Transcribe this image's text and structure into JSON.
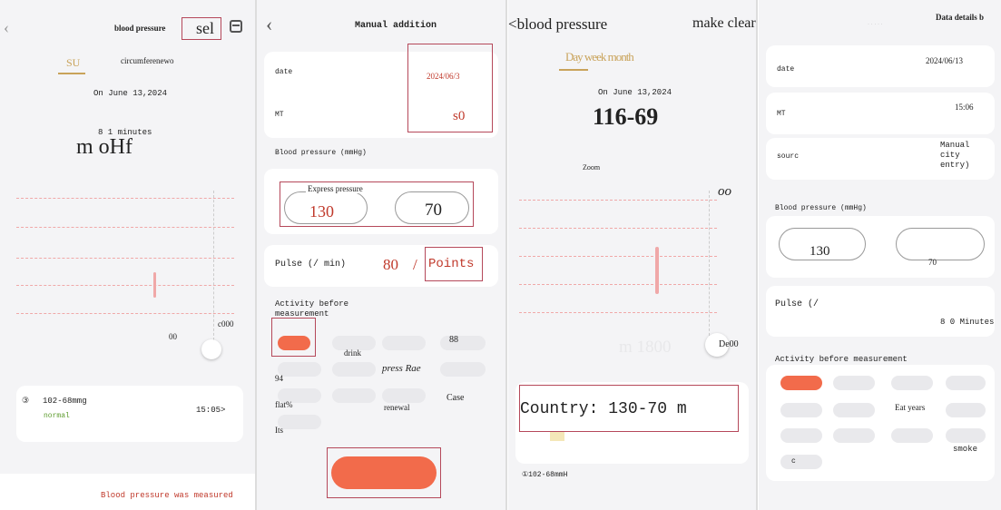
{
  "colors": {
    "accent": "#f26b4b",
    "red_text": "#c0392b",
    "green_text": "#5c9b2c",
    "box": "#b5485a",
    "gold": "#c9a35a"
  },
  "p1": {
    "back_icon": "chevron-left-icon",
    "title": "blood pressure",
    "sel_label": "sel",
    "calendar_icon": "calendar-icon",
    "tab_active": "SU",
    "tab_other": "circumferenewo",
    "date": "On June 13,2024",
    "minutes": "8 1 minutes",
    "reading_big": "m oHf",
    "chart_tick_right": "c000",
    "chart_tick_bottom": "00",
    "record_value": "102-68mmg",
    "record_status": "normal",
    "record_time": "15:05>",
    "bottom_note": "Blood pressure was measured"
  },
  "p2": {
    "back_icon": "chevron-left-icon",
    "title": "Manual addition",
    "date_label": "date",
    "date_value": "2024/06/3",
    "mt_label": "MT",
    "mt_value": "s0",
    "bp_label": "Blood pressure (mmHg)",
    "express_label": "Express pressure",
    "systolic": "130",
    "diastolic": "70",
    "pulse_label": "Pulse (/ min)",
    "pulse_value": "80",
    "pulse_unit": "/",
    "points": "Points",
    "activity_label": "Activity before measurement",
    "tag_drink": "drink",
    "tag_88": "88",
    "tag_94": "94",
    "tag_press": "press Rae",
    "tag_flat": "flat%",
    "tag_renewal": "renewal",
    "tag_case": "Case",
    "tag_its": "Its"
  },
  "p3": {
    "title": "<blood pressure",
    "make_clear": "make clear",
    "tabs": "Day week month",
    "date": "On June 13,2024",
    "reading": "116-69",
    "zoom": "Zoom",
    "oo": "oo",
    "m1800": "m 1800",
    "de00": "De00",
    "country": "Country: 130-70 m",
    "bottom_value": "①102-68mmH"
  },
  "p4": {
    "title": "Data details b",
    "date_label": "date",
    "date_value": "2024/06/13",
    "mt_label": "MT",
    "mt_value": "15:06",
    "source_label": "sourc",
    "source_value": "Manual city entry)",
    "bp_label": "Blood pressure (mmHg)",
    "systolic": "130",
    "diastolic": "70",
    "pulse_label": "Pulse (/",
    "pulse_value": "8 0 Minutes",
    "activity_label": "Activity before measurement",
    "eat_years": "Eat years",
    "smoke": "smoke",
    "c_tag": "c"
  }
}
